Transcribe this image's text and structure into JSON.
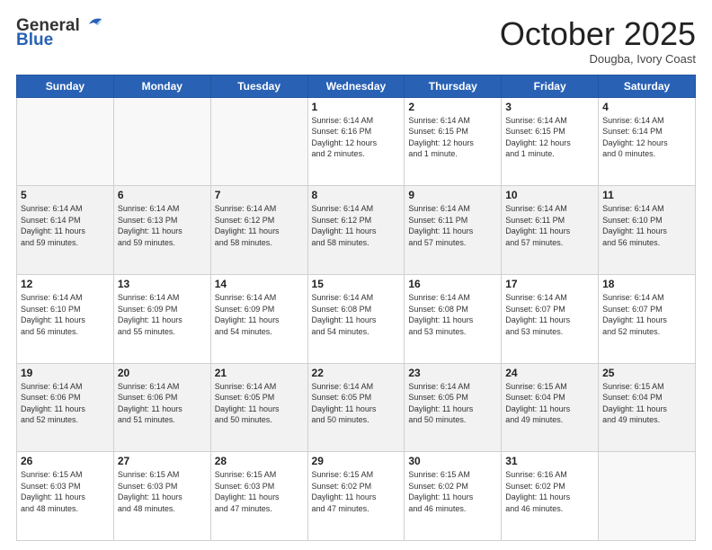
{
  "header": {
    "logo_general": "General",
    "logo_blue": "Blue",
    "month": "October 2025",
    "location": "Dougba, Ivory Coast"
  },
  "weekdays": [
    "Sunday",
    "Monday",
    "Tuesday",
    "Wednesday",
    "Thursday",
    "Friday",
    "Saturday"
  ],
  "weeks": [
    [
      {
        "day": "",
        "info": ""
      },
      {
        "day": "",
        "info": ""
      },
      {
        "day": "",
        "info": ""
      },
      {
        "day": "1",
        "info": "Sunrise: 6:14 AM\nSunset: 6:16 PM\nDaylight: 12 hours\nand 2 minutes."
      },
      {
        "day": "2",
        "info": "Sunrise: 6:14 AM\nSunset: 6:15 PM\nDaylight: 12 hours\nand 1 minute."
      },
      {
        "day": "3",
        "info": "Sunrise: 6:14 AM\nSunset: 6:15 PM\nDaylight: 12 hours\nand 1 minute."
      },
      {
        "day": "4",
        "info": "Sunrise: 6:14 AM\nSunset: 6:14 PM\nDaylight: 12 hours\nand 0 minutes."
      }
    ],
    [
      {
        "day": "5",
        "info": "Sunrise: 6:14 AM\nSunset: 6:14 PM\nDaylight: 11 hours\nand 59 minutes."
      },
      {
        "day": "6",
        "info": "Sunrise: 6:14 AM\nSunset: 6:13 PM\nDaylight: 11 hours\nand 59 minutes."
      },
      {
        "day": "7",
        "info": "Sunrise: 6:14 AM\nSunset: 6:12 PM\nDaylight: 11 hours\nand 58 minutes."
      },
      {
        "day": "8",
        "info": "Sunrise: 6:14 AM\nSunset: 6:12 PM\nDaylight: 11 hours\nand 58 minutes."
      },
      {
        "day": "9",
        "info": "Sunrise: 6:14 AM\nSunset: 6:11 PM\nDaylight: 11 hours\nand 57 minutes."
      },
      {
        "day": "10",
        "info": "Sunrise: 6:14 AM\nSunset: 6:11 PM\nDaylight: 11 hours\nand 57 minutes."
      },
      {
        "day": "11",
        "info": "Sunrise: 6:14 AM\nSunset: 6:10 PM\nDaylight: 11 hours\nand 56 minutes."
      }
    ],
    [
      {
        "day": "12",
        "info": "Sunrise: 6:14 AM\nSunset: 6:10 PM\nDaylight: 11 hours\nand 56 minutes."
      },
      {
        "day": "13",
        "info": "Sunrise: 6:14 AM\nSunset: 6:09 PM\nDaylight: 11 hours\nand 55 minutes."
      },
      {
        "day": "14",
        "info": "Sunrise: 6:14 AM\nSunset: 6:09 PM\nDaylight: 11 hours\nand 54 minutes."
      },
      {
        "day": "15",
        "info": "Sunrise: 6:14 AM\nSunset: 6:08 PM\nDaylight: 11 hours\nand 54 minutes."
      },
      {
        "day": "16",
        "info": "Sunrise: 6:14 AM\nSunset: 6:08 PM\nDaylight: 11 hours\nand 53 minutes."
      },
      {
        "day": "17",
        "info": "Sunrise: 6:14 AM\nSunset: 6:07 PM\nDaylight: 11 hours\nand 53 minutes."
      },
      {
        "day": "18",
        "info": "Sunrise: 6:14 AM\nSunset: 6:07 PM\nDaylight: 11 hours\nand 52 minutes."
      }
    ],
    [
      {
        "day": "19",
        "info": "Sunrise: 6:14 AM\nSunset: 6:06 PM\nDaylight: 11 hours\nand 52 minutes."
      },
      {
        "day": "20",
        "info": "Sunrise: 6:14 AM\nSunset: 6:06 PM\nDaylight: 11 hours\nand 51 minutes."
      },
      {
        "day": "21",
        "info": "Sunrise: 6:14 AM\nSunset: 6:05 PM\nDaylight: 11 hours\nand 50 minutes."
      },
      {
        "day": "22",
        "info": "Sunrise: 6:14 AM\nSunset: 6:05 PM\nDaylight: 11 hours\nand 50 minutes."
      },
      {
        "day": "23",
        "info": "Sunrise: 6:14 AM\nSunset: 6:05 PM\nDaylight: 11 hours\nand 50 minutes."
      },
      {
        "day": "24",
        "info": "Sunrise: 6:15 AM\nSunset: 6:04 PM\nDaylight: 11 hours\nand 49 minutes."
      },
      {
        "day": "25",
        "info": "Sunrise: 6:15 AM\nSunset: 6:04 PM\nDaylight: 11 hours\nand 49 minutes."
      }
    ],
    [
      {
        "day": "26",
        "info": "Sunrise: 6:15 AM\nSunset: 6:03 PM\nDaylight: 11 hours\nand 48 minutes."
      },
      {
        "day": "27",
        "info": "Sunrise: 6:15 AM\nSunset: 6:03 PM\nDaylight: 11 hours\nand 48 minutes."
      },
      {
        "day": "28",
        "info": "Sunrise: 6:15 AM\nSunset: 6:03 PM\nDaylight: 11 hours\nand 47 minutes."
      },
      {
        "day": "29",
        "info": "Sunrise: 6:15 AM\nSunset: 6:02 PM\nDaylight: 11 hours\nand 47 minutes."
      },
      {
        "day": "30",
        "info": "Sunrise: 6:15 AM\nSunset: 6:02 PM\nDaylight: 11 hours\nand 46 minutes."
      },
      {
        "day": "31",
        "info": "Sunrise: 6:16 AM\nSunset: 6:02 PM\nDaylight: 11 hours\nand 46 minutes."
      },
      {
        "day": "",
        "info": ""
      }
    ]
  ]
}
